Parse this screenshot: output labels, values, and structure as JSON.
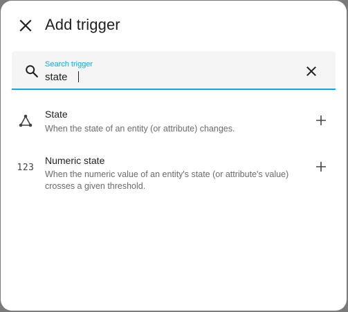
{
  "dialog": {
    "title": "Add trigger"
  },
  "search": {
    "label": "Search trigger",
    "value": "state"
  },
  "triggers": [
    {
      "title": "State",
      "description": "When the state of an entity (or attribute) changes.",
      "icon": "state-graph-icon"
    },
    {
      "title": "Numeric state",
      "description": "When the numeric value of an entity's state (or attribute's value) crosses a given threshold.",
      "icon_text": "123",
      "icon": "numeric-icon"
    }
  ],
  "colors": {
    "accent": "#03a9f4",
    "text": "#212121",
    "secondary_text": "#6b6b6b"
  }
}
